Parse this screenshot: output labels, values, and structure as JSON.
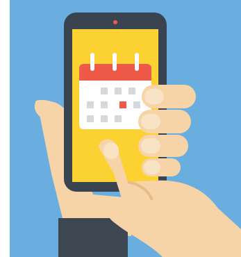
{
  "illustration": {
    "subject": "calendar-app-on-smartphone",
    "icons": [
      "smartphone-icon",
      "calendar-icon",
      "hand-icon",
      "pointing-finger-icon"
    ],
    "colors": {
      "background": "#6aaee0",
      "phone_body": "#3a4450",
      "screen": "#fcd232",
      "calendar_header": "#ee5a4a",
      "calendar_page": "#ffffff",
      "calendar_cells": "#d6d9dc",
      "highlighted_day": "#ee5a4a",
      "skin": "#f6d4a8",
      "skin_shadow": "#e8bc8a",
      "sleeve": "#3d4752"
    },
    "calendar": {
      "rings": 3,
      "grid_rows": 3,
      "grid_cols": 4,
      "highlighted_cell": {
        "row": 1,
        "col": 2
      }
    }
  }
}
